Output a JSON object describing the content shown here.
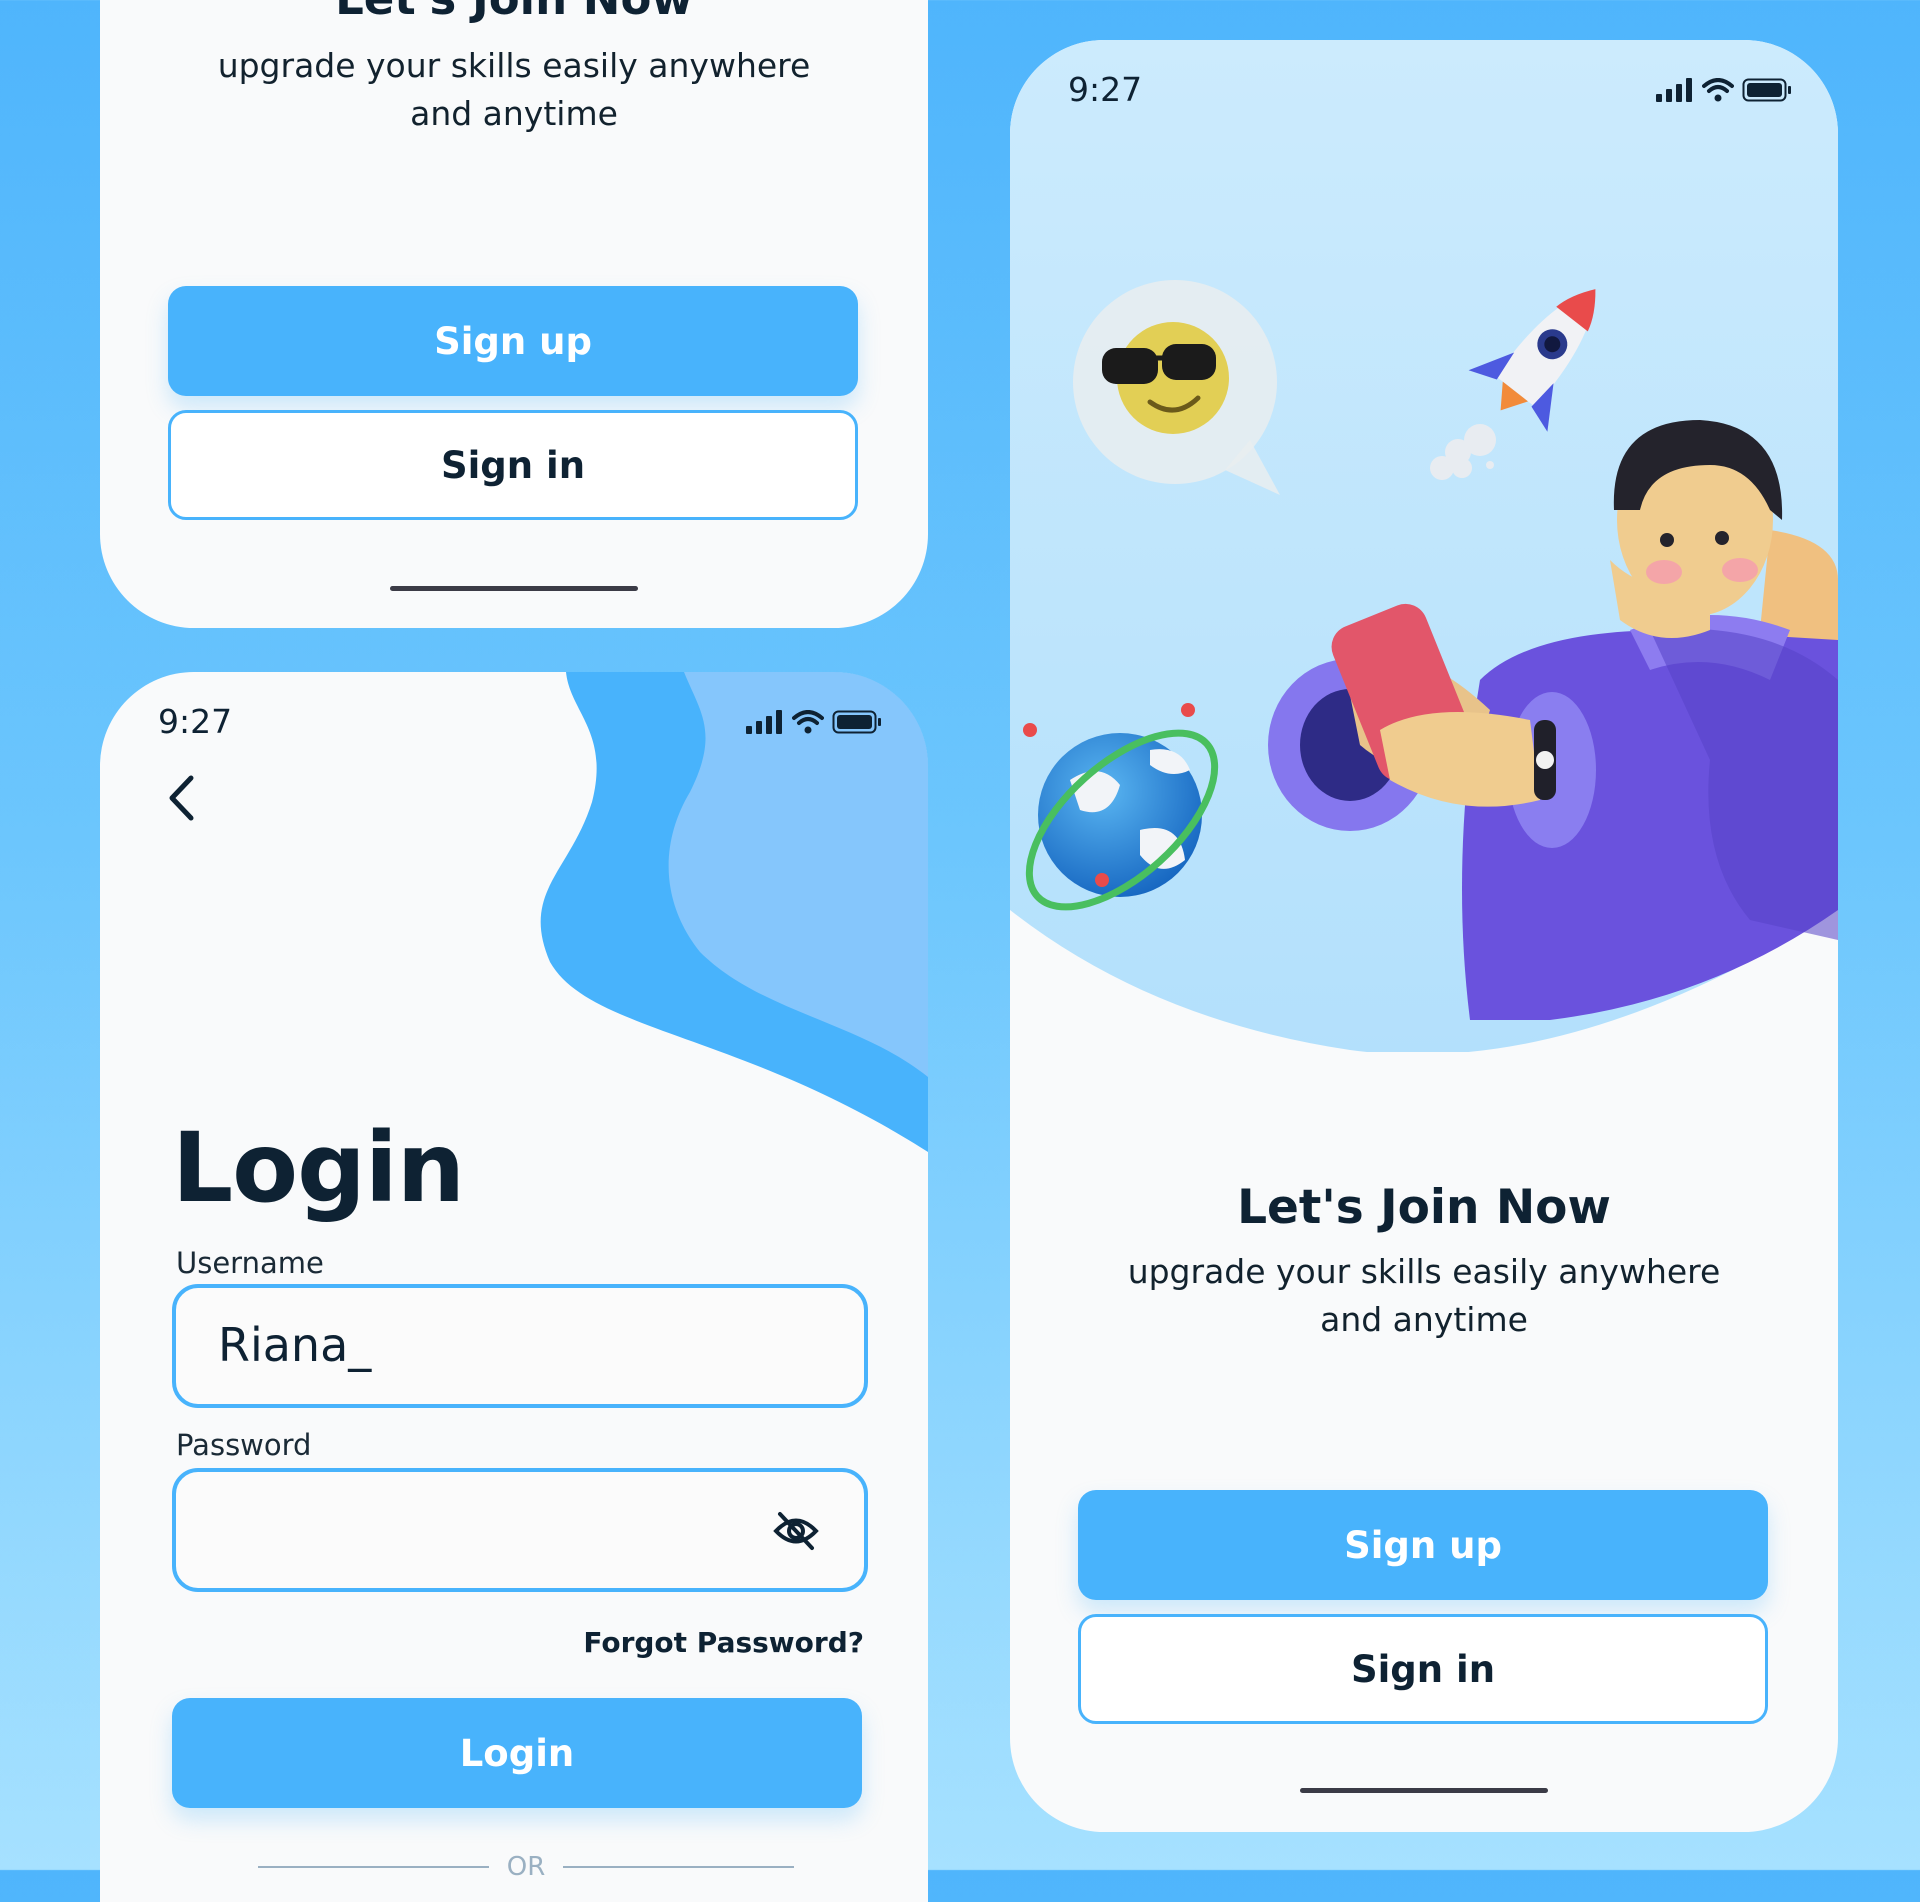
{
  "top_screen": {
    "title": "Let's Join Now",
    "subtitle_line1": "upgrade your skills easily anywhere",
    "subtitle_line2": "and anytime",
    "signup_label": "Sign up",
    "signin_label": "Sign in"
  },
  "login_screen": {
    "status_time": "9:27",
    "heading": "Login",
    "username_label": "Username",
    "username_value": "Riana_",
    "password_label": "Password",
    "password_value": "",
    "forgot_label": "Forgot Password?",
    "login_label": "Login",
    "or_label": "OR"
  },
  "welcome_screen": {
    "status_time": "9:27",
    "title": "Let's Join Now",
    "subtitle_line1": "upgrade your skills easily anywhere",
    "subtitle_line2": "and anytime",
    "signup_label": "Sign up",
    "signin_label": "Sign in"
  },
  "icons": {
    "back": "chevron-left-icon",
    "visibility": "eye-off-icon",
    "signal": "signal-icon",
    "wifi": "wifi-icon",
    "battery": "battery-icon"
  },
  "colors": {
    "accent": "#48b3fc",
    "text_dark": "#0e2233",
    "background": "#f9fafb",
    "wave_dark": "#48b3fc",
    "wave_light": "#85c6fc"
  }
}
